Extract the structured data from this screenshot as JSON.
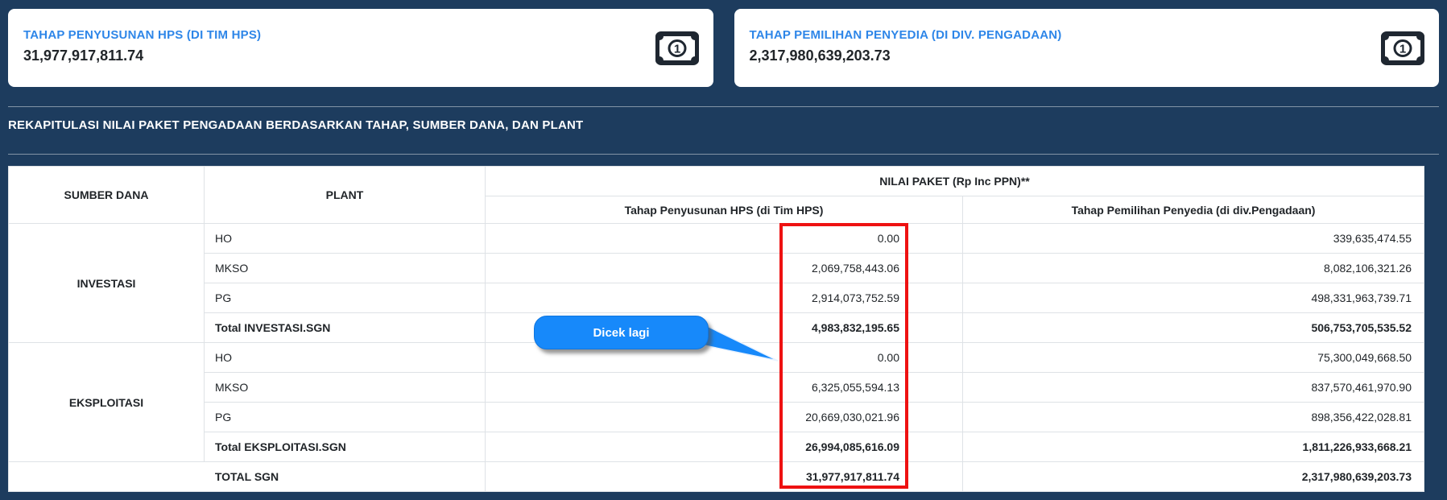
{
  "cards": [
    {
      "label": "TAHAP PENYUSUNAN HPS (DI TIM HPS)",
      "value": "31,977,917,811.74",
      "icon": "money-bill-icon"
    },
    {
      "label": "TAHAP PEMILIHAN PENYEDIA (DI DIV. PENGADAAN)",
      "value": "2,317,980,639,203.73",
      "icon": "money-bill-icon"
    }
  ],
  "section_title": "REKAPITULASI NILAI PAKET PENGADAAN BERDASARKAN TAHAP, SUMBER DANA, DAN PLANT",
  "table": {
    "headers": {
      "sumber_dana": "SUMBER DANA",
      "plant": "PLANT",
      "nilai_paket": "NILAI PAKET (Rp Inc PPN)**",
      "col_hps": "Tahap Penyusunan HPS (di Tim HPS)",
      "col_penyedia": "Tahap Pemilihan Penyedia (di div.Pengadaan)"
    },
    "groups": [
      {
        "sumber_dana": "INVESTASI",
        "rows": [
          {
            "plant": "HO",
            "hps": "0.00",
            "penyedia": "339,635,474.55"
          },
          {
            "plant": "MKSO",
            "hps": "2,069,758,443.06",
            "penyedia": "8,082,106,321.26"
          },
          {
            "plant": "PG",
            "hps": "2,914,073,752.59",
            "penyedia": "498,331,963,739.71"
          },
          {
            "plant": "Total INVESTASI.SGN",
            "hps": "4,983,832,195.65",
            "penyedia": "506,753,705,535.52"
          }
        ]
      },
      {
        "sumber_dana": "EKSPLOITASI",
        "rows": [
          {
            "plant": "HO",
            "hps": "0.00",
            "penyedia": "75,300,049,668.50"
          },
          {
            "plant": "MKSO",
            "hps": "6,325,055,594.13",
            "penyedia": "837,570,461,970.90"
          },
          {
            "plant": "PG",
            "hps": "20,669,030,021.96",
            "penyedia": "898,356,422,028.81"
          },
          {
            "plant": "Total EKSPLOITASI.SGN",
            "hps": "26,994,085,616.09",
            "penyedia": "1,811,226,933,668.21"
          }
        ]
      }
    ],
    "total_row": {
      "label": "TOTAL SGN",
      "hps": "31,977,917,811.74",
      "penyedia": "2,317,980,639,203.73"
    }
  },
  "annotations": {
    "callout_label": "Dicek lagi",
    "highlight_color": "#ee1111",
    "callout_color": "#1789fa"
  }
}
